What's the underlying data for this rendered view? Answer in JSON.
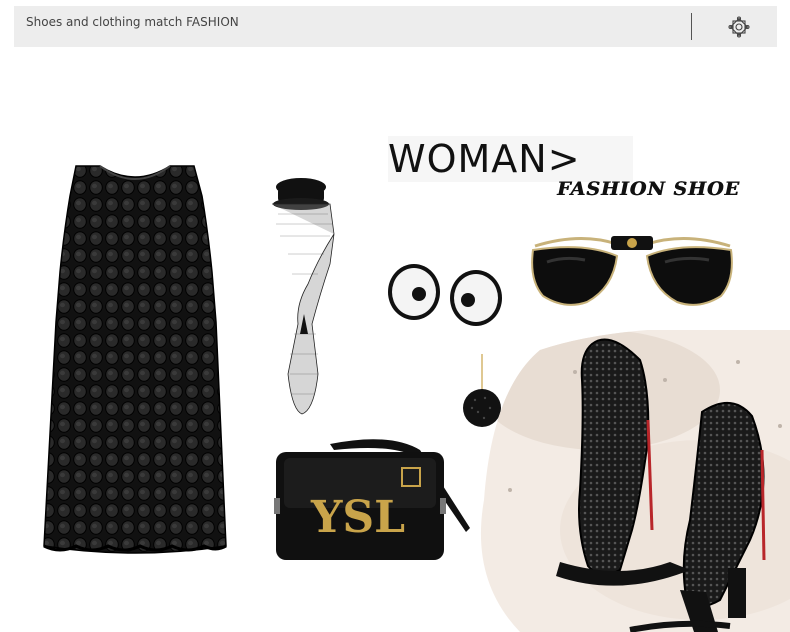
{
  "header": {
    "title": "Shoes and clothing match FASHION",
    "menu_icon": "ornament-icon"
  },
  "collage": {
    "heading": "WOMAN>",
    "subheading": "FASHION SHOE",
    "items": [
      {
        "name": "black-lace-dress"
      },
      {
        "name": "veiled-hat"
      },
      {
        "name": "eye-patches"
      },
      {
        "name": "aviator-sunglasses"
      },
      {
        "name": "pendant-earrings"
      },
      {
        "name": "ysl-shoulder-bag"
      },
      {
        "name": "lace-heels-photo"
      }
    ],
    "bag_logo": "YSL"
  },
  "colors": {
    "topbar_bg": "#ededed",
    "accent_gold": "#c9a44a",
    "shoe_red_sole": "#b8262a"
  }
}
